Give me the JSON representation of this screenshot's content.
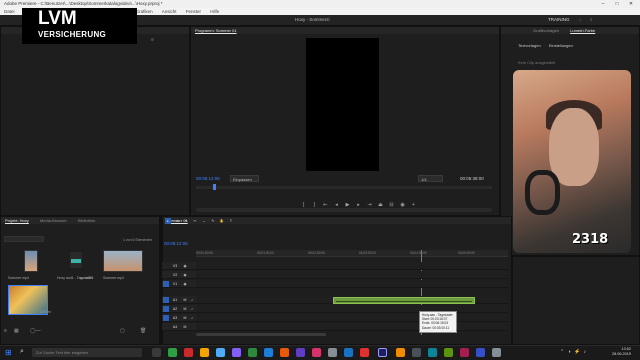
{
  "window": {
    "title": "Adobe Premiere - C:\\Benutzer\\...\\Desktop\\Sommerkatalogvideo\\...\\Hoxy.prproj *",
    "controls": [
      "–",
      "□",
      "✕"
    ]
  },
  "menu": {
    "items": [
      "Datei",
      "Bearbeiten",
      "Clip",
      "Sequenz",
      "Markierungen",
      "Grafiken",
      "Ansicht",
      "Fenster",
      "Hilfe"
    ]
  },
  "workspace": {
    "center_title": "Hoxy - Sommerzi",
    "tab_training": "TRAINING",
    "right_tabs": [
      "Grafikvorlagen",
      "Lumetri-Farbe"
    ]
  },
  "program_monitor": {
    "header": "Programm: Sommer 01",
    "timecode": "00:06:12:06",
    "fit": "Einpassen",
    "resolution": "1/4",
    "duration": "00:06:38:00"
  },
  "lumetri": {
    "tabs": [
      "Textvorlagen",
      "Einstellungen"
    ],
    "status": "Kein Clip ausgewählt"
  },
  "logo": {
    "big": "LVM",
    "small": "VERSICHERUNG"
  },
  "webcam": {
    "score": "2318"
  },
  "project": {
    "tabs": [
      "Projekt: Hoxy",
      "Media-Browser",
      "Bibliothek"
    ],
    "search_placeholder": "",
    "count": "1 von 6 Elementen",
    "items": [
      {
        "label": "Sommer mp4"
      },
      {
        "label": "Hoxy aud1 - Tagmuster"
      },
      {
        "label": "s...m001"
      },
      {
        "label": "Sommer.mp4"
      },
      {
        "label": "1,03 m"
      }
    ]
  },
  "timeline": {
    "header": "Sommer 01",
    "timecode": "00:06:12:06",
    "ruler": [
      "00:00:00:00",
      "00:01:00:00",
      "00:02:00:00",
      "00:03:00:00",
      "00:04:00:00",
      "00:05:00:00"
    ],
    "video_tracks": [
      "V3",
      "V2",
      "V1"
    ],
    "audio_tracks": [
      "A1",
      "A2",
      "A3",
      "A4"
    ],
    "tooltip": [
      "Hoxy.aac - Tagmuster",
      "Start: 00:03:16:07",
      "Ende: 00:06:15:03",
      "Dauer: 00:03:00:11"
    ]
  },
  "taskbar": {
    "search_placeholder": "Zur Suche Text hier eingeben",
    "time": "13:52",
    "date": "28.06.2019"
  },
  "colors": {
    "accent": "#3f80ff",
    "audio_clip": "#6c9a3c",
    "panel_bg": "#1e1e1e"
  }
}
